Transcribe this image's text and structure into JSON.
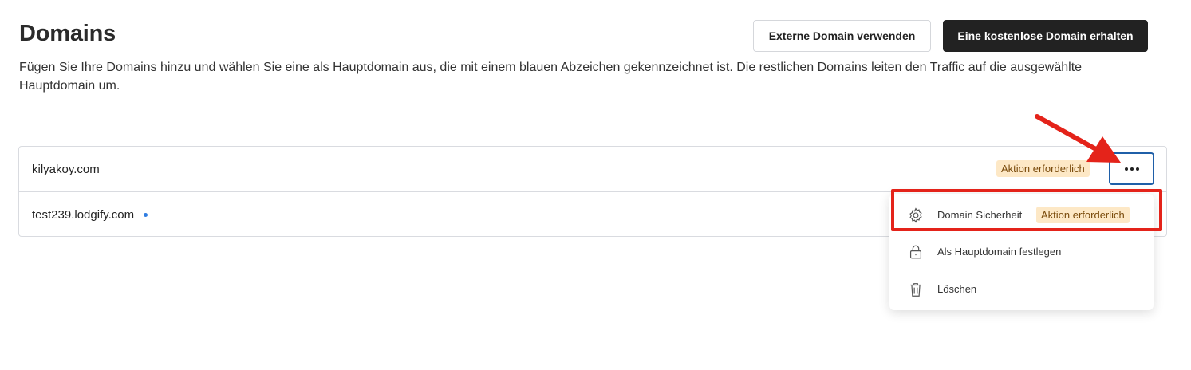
{
  "page": {
    "title": "Domains",
    "description": "Fügen Sie Ihre Domains hinzu und wählen Sie eine als Hauptdomain aus, die mit einem blauen Abzeichen gekennzeichnet ist. Die restlichen Domains leiten den Traffic auf die ausgewählte Hauptdomain um."
  },
  "header_actions": {
    "external_label": "Externe Domain verwenden",
    "free_label": "Eine kostenlose Domain erhalten"
  },
  "domains": [
    {
      "name": "kilyakoy.com",
      "badge": "Aktion erforderlich"
    },
    {
      "name": "test239.lodgify.com",
      "is_main": true
    }
  ],
  "menu": {
    "items": [
      {
        "label": "Domain Sicherheit",
        "icon": "gear-icon",
        "badge": "Aktion erforderlich"
      },
      {
        "label": "Als Hauptdomain festlegen",
        "icon": "lock-icon"
      },
      {
        "label": "Löschen",
        "icon": "trash-icon"
      }
    ]
  },
  "colors": {
    "primary_dark": "#222222",
    "badge_bg": "#fde8c6",
    "badge_text": "#7a4b0c",
    "main_dot": "#2f7de1",
    "annotation_red": "#e4231a",
    "focus_border": "#1f5fa8"
  }
}
